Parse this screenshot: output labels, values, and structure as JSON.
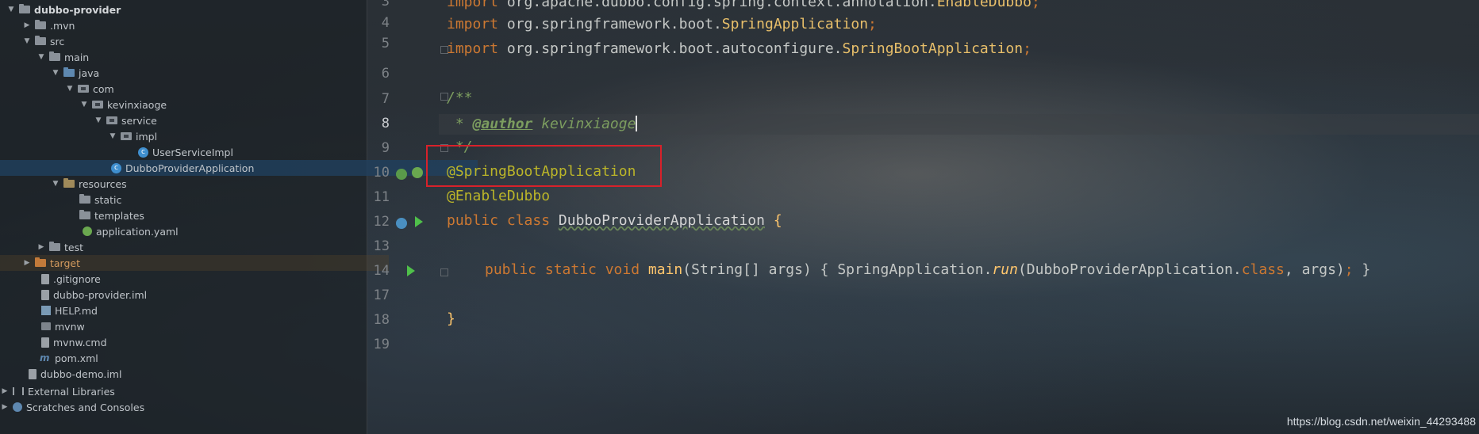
{
  "project_tree": [
    {
      "label": "dubbo-provider",
      "expanded": true,
      "icon": "folder-icon",
      "bold": true
    },
    {
      "label": ".mvn",
      "expanded": false,
      "icon": "folder-icon"
    },
    {
      "label": "src",
      "expanded": true,
      "icon": "folder-icon"
    },
    {
      "label": "main",
      "expanded": true,
      "icon": "folder-icon"
    },
    {
      "label": "java",
      "expanded": true,
      "icon": "source-folder-icon"
    },
    {
      "label": "com",
      "expanded": true,
      "icon": "package-icon"
    },
    {
      "label": "kevinxiaoge",
      "expanded": true,
      "icon": "package-icon"
    },
    {
      "label": "service",
      "expanded": true,
      "icon": "package-icon"
    },
    {
      "label": "impl",
      "expanded": true,
      "icon": "package-icon"
    },
    {
      "label": "UserServiceImpl",
      "icon": "class-icon"
    },
    {
      "label": "DubboProviderApplication",
      "icon": "spring-class-icon",
      "selected": true
    },
    {
      "label": "resources",
      "expanded": true,
      "icon": "resources-folder-icon"
    },
    {
      "label": "static",
      "icon": "folder-icon"
    },
    {
      "label": "templates",
      "icon": "folder-icon"
    },
    {
      "label": "application.yaml",
      "icon": "yaml-file-icon"
    },
    {
      "label": "test",
      "expanded": false,
      "icon": "folder-icon"
    },
    {
      "label": "target",
      "expanded": false,
      "icon": "excluded-folder-icon"
    },
    {
      "label": ".gitignore",
      "icon": "file-icon"
    },
    {
      "label": "dubbo-provider.iml",
      "icon": "iml-file-icon"
    },
    {
      "label": "HELP.md",
      "icon": "markdown-file-icon"
    },
    {
      "label": "mvnw",
      "icon": "shell-file-icon"
    },
    {
      "label": "mvnw.cmd",
      "icon": "file-icon"
    },
    {
      "label": "pom.xml",
      "icon": "maven-file-icon"
    },
    {
      "label": "dubbo-demo.iml",
      "icon": "iml-file-icon"
    },
    {
      "label": "External Libraries",
      "expanded": false,
      "icon": "libraries-icon"
    },
    {
      "label": "Scratches and Consoles",
      "expanded": false,
      "icon": "scratches-icon"
    }
  ],
  "editor": {
    "line_numbers": [
      "3",
      "4",
      "5",
      "6",
      "7",
      "8",
      "9",
      "10",
      "11",
      "12",
      "13",
      "14",
      "17",
      "18",
      "19"
    ],
    "current_line": "8",
    "code": {
      "line3_kw": "import",
      "line3_pkg": " org.apache.dubbo.config.spring.context.annotation.",
      "line3_cls": "EnableDubbo",
      "line4_kw": "import",
      "line4_pkg": " org.springframework.boot.",
      "line4_cls": "SpringApplication",
      "line5_kw": "import",
      "line5_pkg": " org.springframework.boot.autoconfigure.",
      "line5_cls": "SpringBootApplication",
      "semicolon": ";",
      "doc_open": "/**",
      "doc_star": " * ",
      "doc_tag": "@author",
      "doc_author": " kevinxiaoge",
      "doc_close": " */",
      "ann1": "@SpringBootApplication",
      "ann2": "@EnableDubbo",
      "class_kw": "public class ",
      "class_name": "DubboProviderApplication",
      "class_open": " {",
      "main_kw": "public static void ",
      "main_name": "main",
      "main_params": "(String[] args) ",
      "main_body_open": "{ ",
      "main_call_cls": "SpringApplication.",
      "main_call_method": "run",
      "main_call_args": "(DubboProviderApplication.",
      "main_class_kw": "class",
      "main_call_end": ", args)",
      "main_body_close": " }",
      "class_close": "}"
    }
  },
  "watermark": "https://blog.csdn.net/weixin_44293488"
}
